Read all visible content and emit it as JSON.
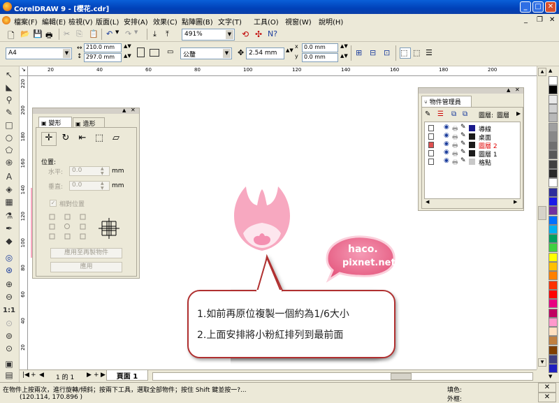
{
  "window": {
    "title": "CorelDRAW 9 - [櫻花.cdr]"
  },
  "menu": [
    "檔案(F)",
    "編輯(E)",
    "檢視(V)",
    "版面(L)",
    "安排(A)",
    "效果(C)",
    "點陣圖(B)",
    "文字(T)",
    "工具(O)",
    "視窗(W)",
    "說明(H)"
  ],
  "toolbar": {
    "zoom": "491%"
  },
  "propbar": {
    "paper": "A4",
    "width": "210.0 mm",
    "height": "297.0 mm",
    "units": "公釐",
    "nudge": "2.54 mm",
    "dup_x": "0.0 mm",
    "dup_y": "0.0 mm"
  },
  "ruler_top": [
    "20",
    "40",
    "60",
    "80",
    "100",
    "120",
    "140",
    "160",
    "180",
    "200"
  ],
  "ruler_left": [
    "220",
    "200",
    "180",
    "160",
    "140",
    "120",
    "100",
    "80",
    "60",
    "40",
    "20"
  ],
  "transform_docker": {
    "tabs": [
      "變形",
      "造形"
    ],
    "section": "位置:",
    "h_label": "水平:",
    "h_value": "0.0",
    "h_unit": "mm",
    "v_label": "垂直:",
    "v_value": "0.0",
    "v_unit": "mm",
    "relative": "相對位置",
    "apply_copy": "應用至再製物件",
    "apply": "應用"
  },
  "object_manager": {
    "title": "物件管理員",
    "layer_label": "圖層:",
    "layer_value": "圖層",
    "layers": [
      {
        "name": "導線",
        "color": "#1a1a8c",
        "active": false
      },
      {
        "name": "桌面",
        "color": "#1a1a1a",
        "active": false
      },
      {
        "name": "圖層 2",
        "color": "#1a1a1a",
        "active": true
      },
      {
        "name": "圖層 1",
        "color": "#1a1a1a",
        "active": false
      },
      {
        "name": "格點",
        "color": "#c8c8c8",
        "active": false
      }
    ]
  },
  "watermark": {
    "line1": "haco.",
    "line2": "pixnet.net"
  },
  "callout": {
    "line1": "1.如前再原位複製一個約為1/6大小",
    "line2": "2.上面安排將小粉紅排列到最前面"
  },
  "pagebar": {
    "count": "1 的 1",
    "tab": "頁面 1"
  },
  "status": {
    "hint": "在物件上按兩次，進行旋轉/傾斜；按兩下工具，選取全部物件；按住 Shift 鍵並按一?...",
    "coords": "(120.114, 170.896 )",
    "fill_label": "填色:",
    "outline_label": "外框:"
  },
  "palette": [
    "#ffffff",
    "#000000",
    "#e8e8e8",
    "#d0d0d0",
    "#b8b8b8",
    "#a0a0a0",
    "#888888",
    "#707070",
    "#585858",
    "#404040",
    "#282828",
    "#ffffff",
    "#2e2e9c",
    "#1a1ae6",
    "#7030a0",
    "#0070ff",
    "#00b0f0",
    "#00a060",
    "#40d040",
    "#ffff00",
    "#ffc000",
    "#ff8000",
    "#ff3000",
    "#ff0000",
    "#e80080",
    "#c00060",
    "#ff99cc",
    "#ffe0c0",
    "#c08040",
    "#804000",
    "#404080",
    "#2020c0"
  ],
  "colors": {
    "blossom": "#f7a8c0",
    "blossom_light": "#fde6ee",
    "blossom_center": "#f48fb1",
    "callout_border": "#b03030",
    "watermark": "#ee6f93"
  }
}
